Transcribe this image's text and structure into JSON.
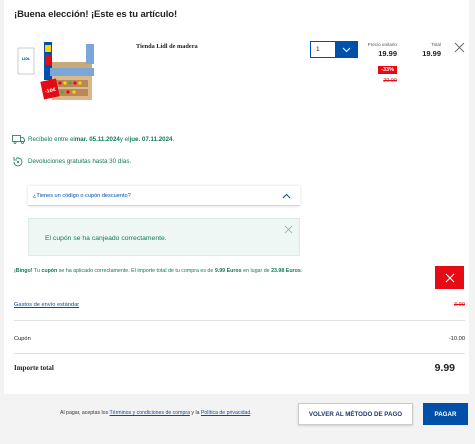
{
  "header": {
    "title": "¡Buena elección! ¡Este es tu artículo!"
  },
  "product": {
    "image_brand_text": "LIDL",
    "image_promo_text": "-10€",
    "name": "Tienda Lidl de madera",
    "quantity": "1",
    "unit_price_label": "Precio unitario",
    "unit_price": "19.99",
    "discount_badge": "-33%",
    "old_price": "29.99",
    "total_label": "Total",
    "total": "19.99"
  },
  "delivery": {
    "prefix": "Recíbelo entre el ",
    "date_from": "mar. 05.11.2024",
    "middle": " y el ",
    "date_to": "jue. 07.11.2024",
    "suffix": "."
  },
  "returns": {
    "text": "Devoluciones gratuitas hasta 30 días."
  },
  "coupon": {
    "toggle_label": "¿Tienes un código o cupón descuento?",
    "success_message": "El cupón se ha canjeado correctamente."
  },
  "bingo": {
    "lead": "¡Bingo!",
    "part1": " Tu ",
    "coupon_word": "cupón",
    "part2": " se ha aplicado correctamente. El importe total de tu compra es de ",
    "new_total": "9.99 Euros",
    "part3": " en lugar de ",
    "old_total": "23.98 Euros",
    "part4": "."
  },
  "summary": {
    "shipping_label": "Gastos de envío estándar",
    "shipping_value": "3.99",
    "coupon_label": "Cupón",
    "coupon_value": "-10.00",
    "total_label": "Importe total",
    "total_value": "9.99"
  },
  "footer": {
    "legal_prefix": "Al pagar, aceptas los ",
    "terms_link": "Términos y condiciones de compra",
    "legal_middle": " y la ",
    "privacy_link": "Política de privacidad",
    "legal_suffix": ".",
    "back_button": "VOLVER AL MÉTODO DE PAGO",
    "pay_button": "PAGAR"
  },
  "colors": {
    "brand_blue": "#0050aa",
    "success_green": "#11795a",
    "alert_red": "#e60a14"
  },
  "icons": [
    "product-image",
    "chevron-down-icon",
    "close-icon",
    "truck-icon",
    "return-icon",
    "chevron-up-icon",
    "trash-icon"
  ]
}
